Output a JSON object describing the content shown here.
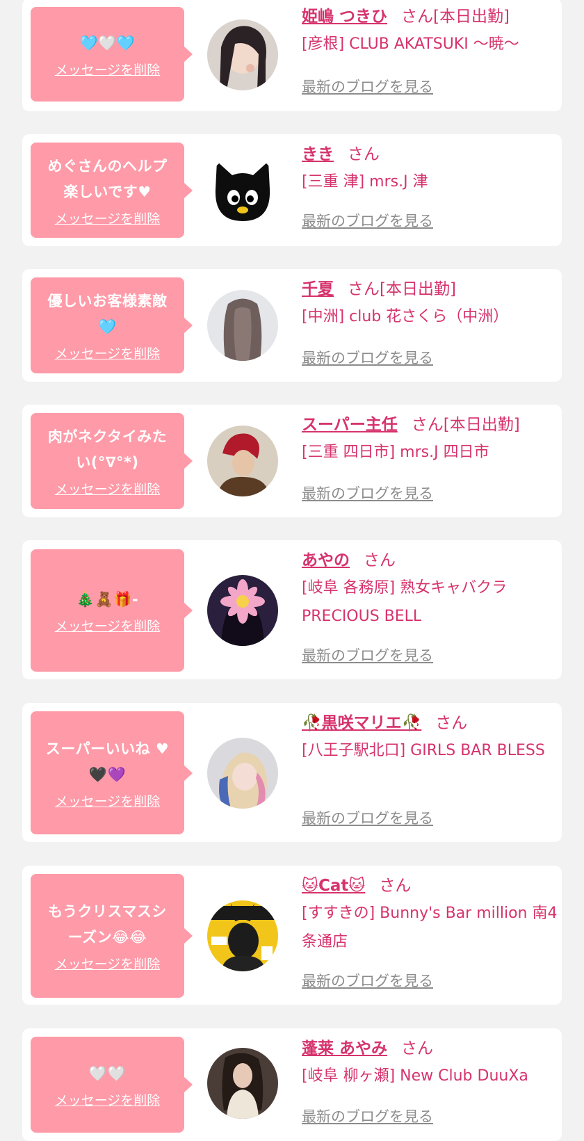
{
  "delete_label": "メッセージを削除",
  "blog_label": "最新のブログを見る",
  "colors": {
    "bubble": "#ff9aa8",
    "accent": "#d6336c",
    "muted": "#8c8c8c",
    "background": "#f2f2f2"
  },
  "entries": [
    {
      "message": "🩵🤍🩵",
      "name": "姫嶋 つきひ",
      "suffix": "さん[本日出勤]",
      "shop": "[彦根] CLUB AKATSUKI 〜暁〜"
    },
    {
      "message": "めぐさんのヘルプ\n楽しいです♥",
      "name": "きき",
      "suffix": "さん",
      "shop": "[三重 津] mrs.J 津"
    },
    {
      "message": "優しいお客様素敵\n🩵",
      "name": "千夏",
      "suffix": "さん[本日出勤]",
      "shop": "[中洲] club 花さくら（中洲）"
    },
    {
      "message": "肉がネクタイみた\nい(°∇°*)",
      "name": "スーパー主任",
      "suffix": "さん[本日出勤]",
      "shop": "[三重 四日市] mrs.J 四日市"
    },
    {
      "message": "🎄🧸🎁-",
      "name": "あやの",
      "suffix": "さん",
      "shop": "[岐阜 各務原]  熟女キャバクラ PRECIOUS BELL"
    },
    {
      "message": "スーパーいいね ♥\n🖤💜",
      "name": "🥀黒咲マリエ🥀",
      "suffix": "さん",
      "shop": "[八王子駅北口] GIRLS BAR BLESS"
    },
    {
      "message": "もうクリスマスシ\nーズン😂😂",
      "name": "🐱Cat🐱",
      "suffix": "さん",
      "shop": "[すすきの] Bunny's Bar million 南4条通店"
    },
    {
      "message": "🤍🤍",
      "name": "蓬莱 あやみ",
      "suffix": "さん",
      "shop": "[岐阜 柳ヶ瀬] New Club DuuXa"
    }
  ]
}
